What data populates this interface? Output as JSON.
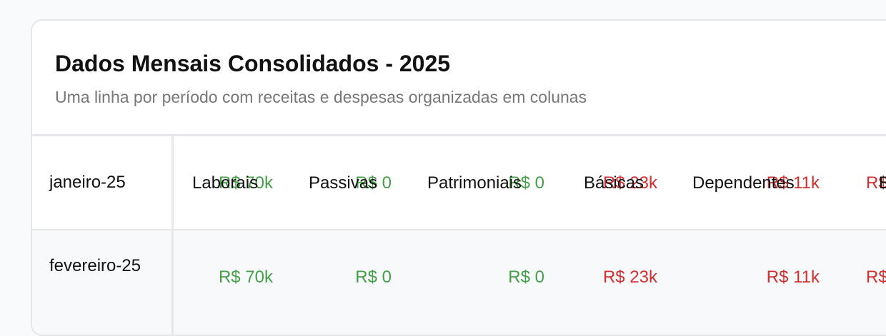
{
  "header": {
    "title": "Dados Mensais Consolidados - 2025",
    "subtitle": "Uma linha por período com receitas e despesas organizadas em colunas"
  },
  "column_labels": [
    "Laborais",
    "Passivas",
    "Patrimoniais",
    "Básicas",
    "Dependentes",
    "E"
  ],
  "rows": [
    {
      "period": "janeiro-25",
      "values": [
        "R$ 70k",
        "R$ 0",
        "R$ 0",
        "R$ 23k",
        "R$ 11k",
        "R$"
      ]
    },
    {
      "period": "fevereiro-25",
      "values": [
        "R$ 70k",
        "R$ 0",
        "R$ 0",
        "R$ 23k",
        "R$ 11k",
        "R$"
      ]
    }
  ],
  "colors": {
    "income": "#43a047",
    "expense": "#d32f2f"
  }
}
